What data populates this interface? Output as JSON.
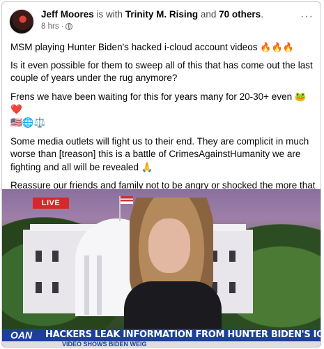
{
  "post": {
    "author": "Jeff Moores",
    "with_label": "is with",
    "tagged": "Trinity M. Rising",
    "and_label": "and",
    "others": "70 others",
    "period": ".",
    "time": "8 hrs",
    "dot": "·",
    "more_icon": "more-options-icon",
    "paragraphs": [
      "MSM playing Hunter Biden's hacked i-cloud account videos",
      " Is it even possible for them to sweep all of this that has come out the last couple of years under the rug anymore?",
      "Frens we have been waiting for this for years many for 20-30+ even",
      "Some media outlets will fight us to their end. They are complicit in much worse than [treason] this is a battle of CrimesAgainstHumanity we are fighting and all will be revealed",
      " Reassure our friends and family not to be angry or shocked the more that comes out. This is just the beginning of the disclosure.."
    ],
    "emojis": {
      "fire": "🔥🔥🔥",
      "frog_heart": "🐸❤️",
      "flag_globe_scale": "🇺🇸🌐⚖️",
      "pray": "🙏"
    }
  },
  "video": {
    "live_label": "LIVE",
    "network_logo": "OAN",
    "headline": "HACKERS LEAK INFORMATION FROM HUNTER BIDEN'S ICLOUD ACCOUNT",
    "subheadline": "VIDEO SHOWS BIDEN WEIG"
  },
  "colors": {
    "live_red": "#d4292b",
    "chyron_blue": "#1d3f9a",
    "muted_text": "#65676b"
  }
}
